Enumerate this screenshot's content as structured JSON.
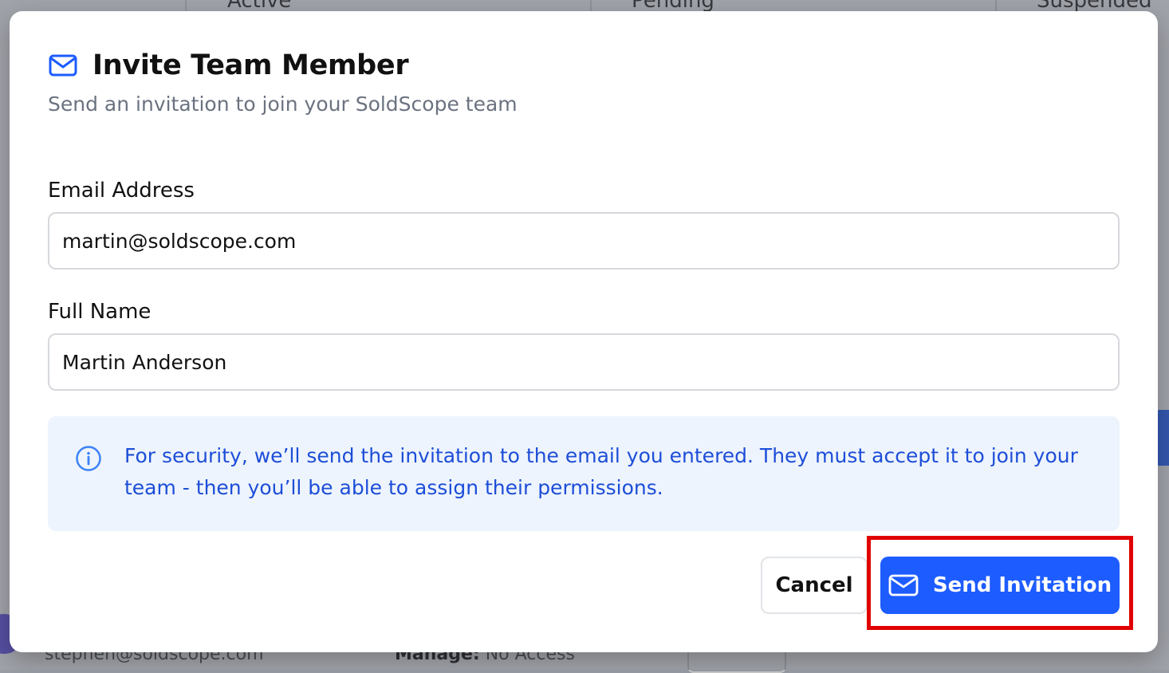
{
  "background": {
    "stats": [
      "Active",
      "Pending",
      "Suspended"
    ],
    "member_email": "stephen@soldscope.com",
    "manage_label": "Manage:",
    "manage_value": "No Access"
  },
  "modal": {
    "title": "Invite Team Member",
    "subtitle": "Send an invitation to join your SoldScope team",
    "icon": "mail-icon",
    "email": {
      "label": "Email Address",
      "value": "martin@soldscope.com"
    },
    "full_name": {
      "label": "Full Name",
      "value": "Martin Anderson"
    },
    "info": {
      "icon": "info-icon",
      "text": "For security, we’ll send the invitation to the email you entered. They must accept it to join your team - then you’ll be able to assign their permissions."
    },
    "buttons": {
      "cancel": "Cancel",
      "send": "Send Invitation"
    }
  },
  "colors": {
    "accent": "#1d5cff",
    "info_bg": "#eef4fd",
    "info_text": "#1d4ed8",
    "highlight": "#e00000"
  }
}
